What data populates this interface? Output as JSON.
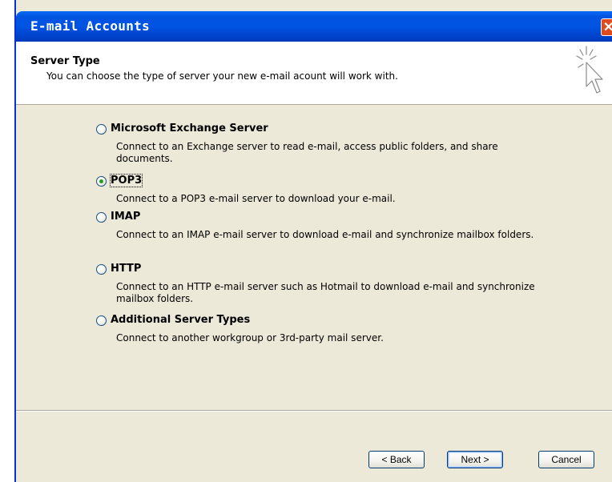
{
  "window": {
    "title": "E-mail Accounts"
  },
  "header": {
    "title": "Server Type",
    "subtitle": "You can choose the type of server your new e-mail acount will work with."
  },
  "options": [
    {
      "label": "Microsoft Exchange Server",
      "description": "Connect to an Exchange server to read e-mail, access public folders, and share documents.",
      "checked": false
    },
    {
      "label": "POP3",
      "description": "Connect to a POP3 e-mail server to download your e-mail.",
      "checked": true
    },
    {
      "label": "IMAP",
      "description": "Connect to an IMAP e-mail server to download e-mail and synchronize mailbox folders.",
      "checked": false
    },
    {
      "label": "HTTP",
      "description": "Connect to an HTTP e-mail server such as Hotmail to download e-mail and synchronize mailbox folders.",
      "checked": false
    },
    {
      "label": "Additional Server Types",
      "description": "Connect to another workgroup or 3rd-party mail server.",
      "checked": false
    }
  ],
  "buttons": {
    "back": "< Back",
    "next": "Next >",
    "cancel": "Cancel"
  },
  "colors": {
    "titlebar": "#0054e3",
    "dialog_bg": "#ece9d8",
    "header_bg": "#ffffff",
    "close": "#e04b1e"
  }
}
